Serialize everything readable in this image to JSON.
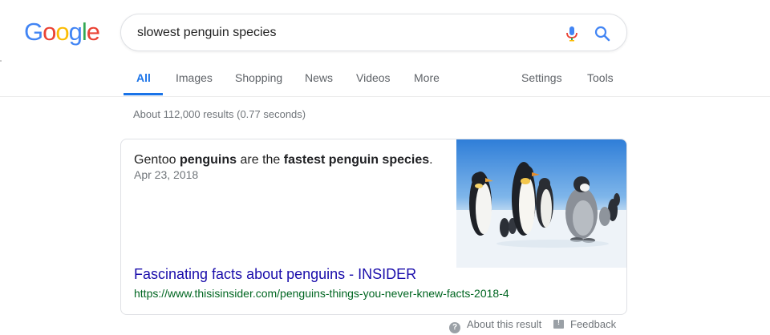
{
  "logo": {
    "letters": [
      "G",
      "o",
      "o",
      "g",
      "l",
      "e"
    ],
    "colors": [
      "#4285F4",
      "#EA4335",
      "#FBBC05",
      "#4285F4",
      "#34A853",
      "#EA4335"
    ]
  },
  "search": {
    "value": "slowest penguin species",
    "mic_icon": "microphone-icon",
    "search_icon": "magnifier-icon"
  },
  "tabs": [
    {
      "label": "All",
      "active": true
    },
    {
      "label": "Images"
    },
    {
      "label": "Shopping"
    },
    {
      "label": "News"
    },
    {
      "label": "Videos"
    },
    {
      "label": "More"
    }
  ],
  "tools": [
    {
      "label": "Settings"
    },
    {
      "label": "Tools"
    }
  ],
  "stats": "About 112,000 results (0.77 seconds)",
  "featured": {
    "snippet_parts": [
      {
        "text": "Gentoo ",
        "bold": false
      },
      {
        "text": "penguins",
        "bold": true
      },
      {
        "text": " are the ",
        "bold": false
      },
      {
        "text": "fastest penguin species",
        "bold": true
      },
      {
        "text": ".",
        "bold": false
      }
    ],
    "date": "Apr 23, 2018",
    "image_subject": "penguin-photo",
    "title": "Fascinating facts about penguins - INSIDER",
    "url": "https://www.thisisinsider.com/penguins-things-you-never-knew-facts-2018-4"
  },
  "footer": {
    "about": "About this result",
    "feedback": "Feedback"
  },
  "colors": {
    "accent": "#1a73e8",
    "link": "#1a0dab",
    "url": "#006621"
  }
}
